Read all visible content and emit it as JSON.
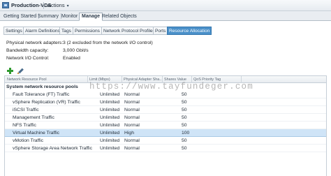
{
  "window": {
    "title": "Production-VDS",
    "actions_label": "Actions",
    "actions_caret": "▾"
  },
  "top_tabs": [
    {
      "label": "Getting Started",
      "active": false
    },
    {
      "label": "Summary",
      "active": false
    },
    {
      "label": "Monitor",
      "active": false
    },
    {
      "label": "Manage",
      "active": true
    },
    {
      "label": "Related Objects",
      "active": false
    }
  ],
  "sub_tabs": [
    {
      "label": "Settings",
      "active": false
    },
    {
      "label": "Alarm Definitions",
      "active": false
    },
    {
      "label": "Tags",
      "active": false
    },
    {
      "label": "Permissions",
      "active": false
    },
    {
      "label": "Network Protocol Profiles",
      "active": false
    },
    {
      "label": "Ports",
      "active": false
    },
    {
      "label": "Resource Allocation",
      "active": true
    }
  ],
  "properties": [
    {
      "label": "Physical network adapters:",
      "value": "3 (2 excluded from the network I/O control)"
    },
    {
      "label": "Bandwidth capacity:",
      "value": "3,000 Gbit/s"
    },
    {
      "label": "Network I/O Control:",
      "value": "Enabled"
    }
  ],
  "toolbar": {
    "add_icon": "plus-icon",
    "edit_icon": "pencil-icon"
  },
  "grid": {
    "columns": [
      "Network Resource Pool",
      "Limit (Mbps)",
      "Physical Adapter Sha...",
      "Shares Value",
      "QoS Priority Tag"
    ],
    "group_label": "System network resource pools",
    "rows": [
      {
        "name": "Fault Tolerance (FT) Traffic",
        "limit": "Unlimited",
        "shares": "Normal",
        "value": "50",
        "qos": "",
        "selected": false
      },
      {
        "name": "vSphere Replication (VR) Traffic",
        "limit": "Unlimited",
        "shares": "Normal",
        "value": "50",
        "qos": "",
        "selected": false
      },
      {
        "name": "iSCSI Traffic",
        "limit": "Unlimited",
        "shares": "Normal",
        "value": "50",
        "qos": "",
        "selected": false
      },
      {
        "name": "Management Traffic",
        "limit": "Unlimited",
        "shares": "Normal",
        "value": "50",
        "qos": "",
        "selected": false
      },
      {
        "name": "NFS Traffic",
        "limit": "Unlimited",
        "shares": "Normal",
        "value": "50",
        "qos": "",
        "selected": false
      },
      {
        "name": "Virtual Machine Traffic",
        "limit": "Unlimited",
        "shares": "High",
        "value": "100",
        "qos": "",
        "selected": true
      },
      {
        "name": "vMotion Traffic",
        "limit": "Unlimited",
        "shares": "Normal",
        "value": "50",
        "qos": "",
        "selected": false
      },
      {
        "name": "vSphere Storage Area Network Traffic",
        "limit": "Unlimited",
        "shares": "Normal",
        "value": "50",
        "qos": "",
        "selected": false
      }
    ]
  },
  "watermark": "https://www.tayfundeger.com",
  "colors": {
    "accent": "#4a90c9",
    "selected_row": "#cfe4f7",
    "add_green": "#2f9a2f"
  }
}
